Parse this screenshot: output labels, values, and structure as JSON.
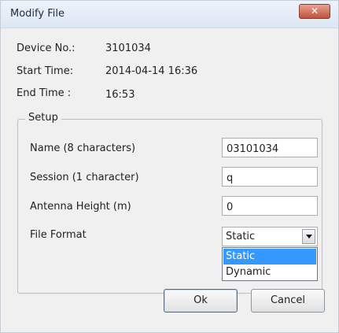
{
  "window": {
    "title": "Modify File",
    "close_glyph": "✕"
  },
  "info": {
    "device_label": "Device No.:",
    "device_value": "3101034",
    "start_label": "Start Time:",
    "start_value": "2014-04-14 16:36",
    "end_label": "End Time :",
    "end_value": "16:53"
  },
  "setup": {
    "group_title": "Setup",
    "name_label": "Name (8 characters)",
    "name_value": "03101034",
    "session_label": "Session (1 character)",
    "session_value": "q",
    "antenna_label": "Antenna Height (m)",
    "antenna_value": "0",
    "format_label": "File Format",
    "format_selected": "Static",
    "format_options": [
      "Static",
      "Dynamic"
    ]
  },
  "buttons": {
    "ok": "Ok",
    "cancel": "Cancel"
  },
  "colors": {
    "selection": "#3399ff",
    "close_button": "#c0513d"
  }
}
